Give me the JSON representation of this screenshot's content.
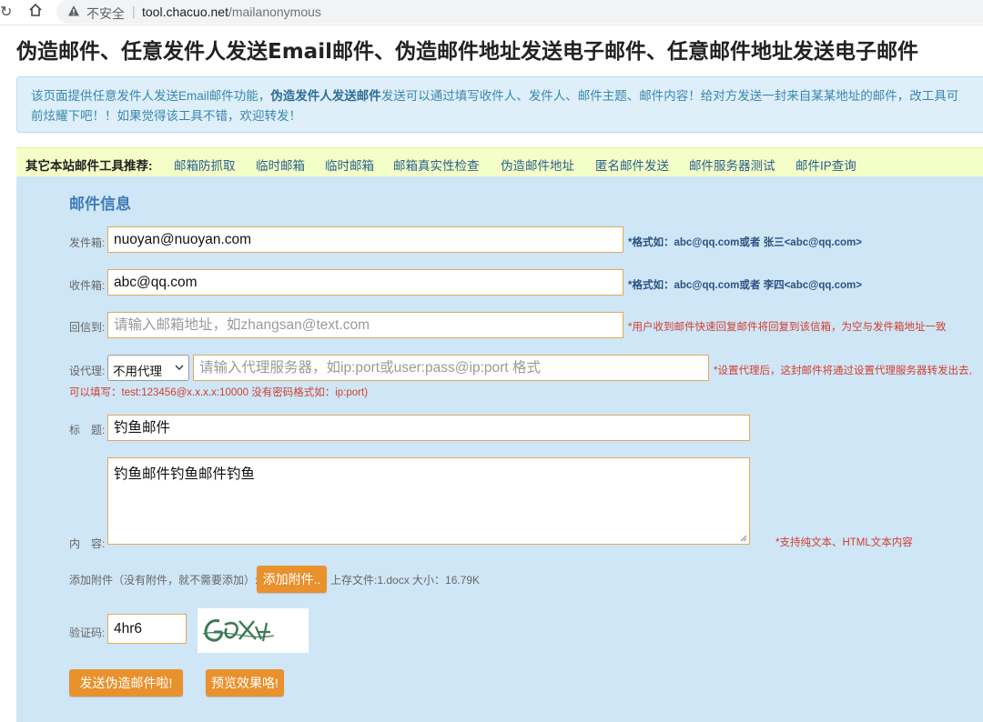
{
  "browser": {
    "insecure_label": "不安全",
    "separator": "|",
    "url_host": "tool.chacuo.net",
    "url_path": "/mailanonymous"
  },
  "page": {
    "title": "伪造邮件、任意发件人发送Email邮件、伪造邮件地址发送电子邮件、任意邮件地址发送电子邮件"
  },
  "info": {
    "line_part1": "该页面提供任意发件人发送Email邮件功能，",
    "line_bold": "伪造发件人发送邮件",
    "line_part2": "发送可以通过填写收件人、发件人、邮件主题、邮件内容！给对方发送一封来自某某地址的邮件，改工具可",
    "line2": "前炫耀下吧！！如果觉得该工具不错，欢迎转发！"
  },
  "tools": {
    "label": "其它本站邮件工具推荐:",
    "links": [
      "邮箱防抓取",
      "临时邮箱",
      "临时邮箱",
      "邮箱真实性检查",
      "伪造邮件地址",
      "匿名邮件发送",
      "邮件服务器测试",
      "邮件IP查询"
    ]
  },
  "form": {
    "section_title": "邮件信息",
    "from": {
      "label": "发件箱:",
      "value": "nuoyan@nuoyan.com",
      "hint": "*格式如：abc@qq.com或者 张三<abc@qq.com>"
    },
    "to": {
      "label": "收件箱:",
      "value": "abc@qq.com",
      "hint": "*格式如：abc@qq.com或者 李四<abc@qq.com>"
    },
    "reply": {
      "label": "回信到:",
      "placeholder": "请输入邮箱地址，如zhangsan@text.com",
      "hint": "*用户收到邮件快速回复邮件将回复到该信箱，为空与发件箱地址一致"
    },
    "proxy": {
      "label": "设代理:",
      "select_value": "不用代理",
      "placeholder": "请输入代理服务器，如ip:port或user:pass@ip:port 格式",
      "hint": "*设置代理后，这封邮件将通过设置代理服务器转发出去,",
      "hint2": "可以填写：test:123456@x.x.x.x:10000 没有密码格式如：ip:port)"
    },
    "subject": {
      "label": "标　题:",
      "value": "钓鱼邮件"
    },
    "content": {
      "label": "内　容:",
      "value": "钓鱼邮件钓鱼邮件钓鱼",
      "hint": "*支持纯文本、HTML文本内容"
    },
    "attach": {
      "label": "添加附件（没有附件，就不需要添加）:",
      "button": "添加附件..",
      "uploaded": "上存文件:1.docx 大小：16.79K"
    },
    "captcha": {
      "label": "验证码:",
      "value": "4hr6"
    },
    "send_button": "发送伪造邮件啦!",
    "preview_button": "预览效果咯!"
  },
  "colors": {
    "accent_orange": "#e8912d",
    "panel_blue": "#cfe6f7",
    "tools_yellow": "#f4ffc7",
    "hint_red": "#d0402e"
  }
}
